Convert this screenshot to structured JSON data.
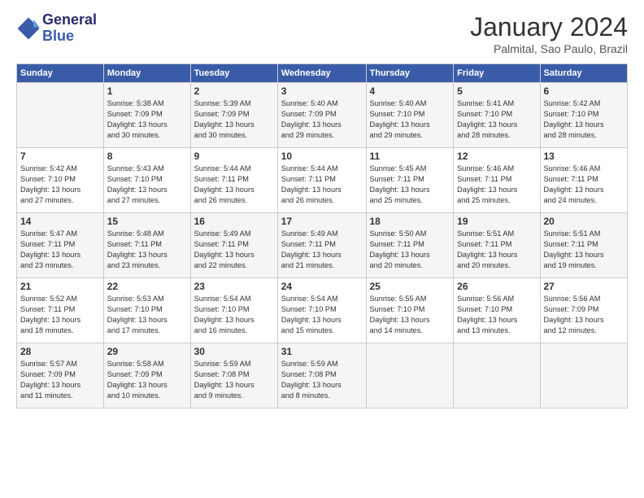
{
  "header": {
    "logo_line1": "General",
    "logo_line2": "Blue",
    "month_year": "January 2024",
    "location": "Palmital, Sao Paulo, Brazil"
  },
  "days_of_week": [
    "Sunday",
    "Monday",
    "Tuesday",
    "Wednesday",
    "Thursday",
    "Friday",
    "Saturday"
  ],
  "weeks": [
    [
      {
        "day": "",
        "content": ""
      },
      {
        "day": "1",
        "content": "Sunrise: 5:38 AM\nSunset: 7:09 PM\nDaylight: 13 hours\nand 30 minutes."
      },
      {
        "day": "2",
        "content": "Sunrise: 5:39 AM\nSunset: 7:09 PM\nDaylight: 13 hours\nand 30 minutes."
      },
      {
        "day": "3",
        "content": "Sunrise: 5:40 AM\nSunset: 7:09 PM\nDaylight: 13 hours\nand 29 minutes."
      },
      {
        "day": "4",
        "content": "Sunrise: 5:40 AM\nSunset: 7:10 PM\nDaylight: 13 hours\nand 29 minutes."
      },
      {
        "day": "5",
        "content": "Sunrise: 5:41 AM\nSunset: 7:10 PM\nDaylight: 13 hours\nand 28 minutes."
      },
      {
        "day": "6",
        "content": "Sunrise: 5:42 AM\nSunset: 7:10 PM\nDaylight: 13 hours\nand 28 minutes."
      }
    ],
    [
      {
        "day": "7",
        "content": "Sunrise: 5:42 AM\nSunset: 7:10 PM\nDaylight: 13 hours\nand 27 minutes."
      },
      {
        "day": "8",
        "content": "Sunrise: 5:43 AM\nSunset: 7:10 PM\nDaylight: 13 hours\nand 27 minutes."
      },
      {
        "day": "9",
        "content": "Sunrise: 5:44 AM\nSunset: 7:11 PM\nDaylight: 13 hours\nand 26 minutes."
      },
      {
        "day": "10",
        "content": "Sunrise: 5:44 AM\nSunset: 7:11 PM\nDaylight: 13 hours\nand 26 minutes."
      },
      {
        "day": "11",
        "content": "Sunrise: 5:45 AM\nSunset: 7:11 PM\nDaylight: 13 hours\nand 25 minutes."
      },
      {
        "day": "12",
        "content": "Sunrise: 5:46 AM\nSunset: 7:11 PM\nDaylight: 13 hours\nand 25 minutes."
      },
      {
        "day": "13",
        "content": "Sunrise: 5:46 AM\nSunset: 7:11 PM\nDaylight: 13 hours\nand 24 minutes."
      }
    ],
    [
      {
        "day": "14",
        "content": "Sunrise: 5:47 AM\nSunset: 7:11 PM\nDaylight: 13 hours\nand 23 minutes."
      },
      {
        "day": "15",
        "content": "Sunrise: 5:48 AM\nSunset: 7:11 PM\nDaylight: 13 hours\nand 23 minutes."
      },
      {
        "day": "16",
        "content": "Sunrise: 5:49 AM\nSunset: 7:11 PM\nDaylight: 13 hours\nand 22 minutes."
      },
      {
        "day": "17",
        "content": "Sunrise: 5:49 AM\nSunset: 7:11 PM\nDaylight: 13 hours\nand 21 minutes."
      },
      {
        "day": "18",
        "content": "Sunrise: 5:50 AM\nSunset: 7:11 PM\nDaylight: 13 hours\nand 20 minutes."
      },
      {
        "day": "19",
        "content": "Sunrise: 5:51 AM\nSunset: 7:11 PM\nDaylight: 13 hours\nand 20 minutes."
      },
      {
        "day": "20",
        "content": "Sunrise: 5:51 AM\nSunset: 7:11 PM\nDaylight: 13 hours\nand 19 minutes."
      }
    ],
    [
      {
        "day": "21",
        "content": "Sunrise: 5:52 AM\nSunset: 7:11 PM\nDaylight: 13 hours\nand 18 minutes."
      },
      {
        "day": "22",
        "content": "Sunrise: 5:53 AM\nSunset: 7:10 PM\nDaylight: 13 hours\nand 17 minutes."
      },
      {
        "day": "23",
        "content": "Sunrise: 5:54 AM\nSunset: 7:10 PM\nDaylight: 13 hours\nand 16 minutes."
      },
      {
        "day": "24",
        "content": "Sunrise: 5:54 AM\nSunset: 7:10 PM\nDaylight: 13 hours\nand 15 minutes."
      },
      {
        "day": "25",
        "content": "Sunrise: 5:55 AM\nSunset: 7:10 PM\nDaylight: 13 hours\nand 14 minutes."
      },
      {
        "day": "26",
        "content": "Sunrise: 5:56 AM\nSunset: 7:10 PM\nDaylight: 13 hours\nand 13 minutes."
      },
      {
        "day": "27",
        "content": "Sunrise: 5:56 AM\nSunset: 7:09 PM\nDaylight: 13 hours\nand 12 minutes."
      }
    ],
    [
      {
        "day": "28",
        "content": "Sunrise: 5:57 AM\nSunset: 7:09 PM\nDaylight: 13 hours\nand 11 minutes."
      },
      {
        "day": "29",
        "content": "Sunrise: 5:58 AM\nSunset: 7:09 PM\nDaylight: 13 hours\nand 10 minutes."
      },
      {
        "day": "30",
        "content": "Sunrise: 5:59 AM\nSunset: 7:08 PM\nDaylight: 13 hours\nand 9 minutes."
      },
      {
        "day": "31",
        "content": "Sunrise: 5:59 AM\nSunset: 7:08 PM\nDaylight: 13 hours\nand 8 minutes."
      },
      {
        "day": "",
        "content": ""
      },
      {
        "day": "",
        "content": ""
      },
      {
        "day": "",
        "content": ""
      }
    ]
  ]
}
